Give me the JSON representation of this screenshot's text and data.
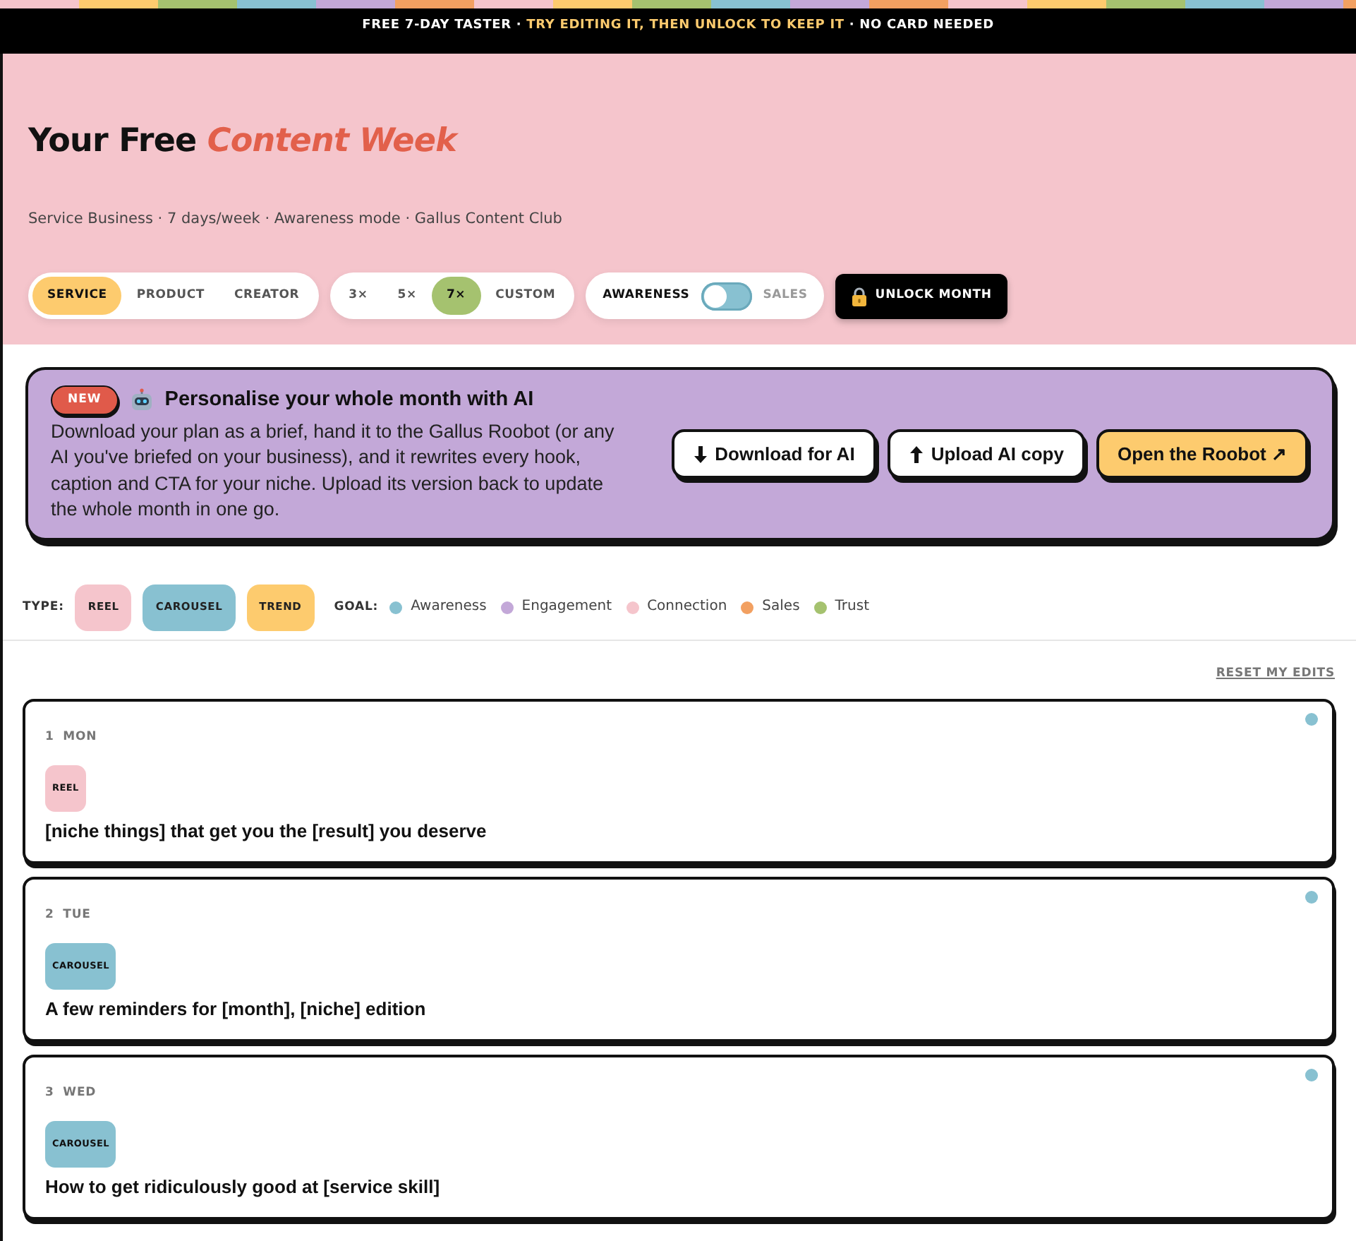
{
  "banner": {
    "segments": [
      {
        "text": "FREE 7-DAY TASTER · ",
        "highlight": false
      },
      {
        "text": "TRY EDITING IT, THEN UNLOCK TO KEEP IT",
        "highlight": true
      },
      {
        "text": " · NO CARD NEEDED",
        "highlight": false
      }
    ]
  },
  "header": {
    "title": "Your Free *Content Week*",
    "subtitle": "Service Business · 7 days/week · Awareness mode · Gallus Content Club"
  },
  "business_type": [
    {
      "label": "SERVICE",
      "selected": true
    },
    {
      "label": "PRODUCT",
      "selected": false
    },
    {
      "label": "CREATOR",
      "selected": false
    }
  ],
  "frequency": [
    {
      "label": "3×",
      "selected": false
    },
    {
      "label": "5×",
      "selected": false
    },
    {
      "label": "7×",
      "selected": true
    },
    {
      "label": "CUSTOM",
      "selected": false
    }
  ],
  "mode_toggle": {
    "left_label": "AWARENESS",
    "right_label": "SALES",
    "on": false
  },
  "unlock_button": {
    "label": "UNLOCK MONTH"
  },
  "ai_promo": {
    "badge": "NEW",
    "title": "Personalise your whole month with AI",
    "text": "Download your plan as a brief, hand it to the Gallus Roobot (or any AI you've briefed on your business), and it rewrites every hook, caption and CTA for your niche. Upload its version back to update the whole month in one go.",
    "buttons": [
      {
        "label": "Download for AI",
        "kind": "download"
      },
      {
        "label": "Upload AI copy",
        "kind": "upload"
      },
      {
        "label": "Open the Roobot ↗",
        "kind": "accent"
      }
    ]
  },
  "legend": {
    "type_label": "TYPE:",
    "types": [
      {
        "label": "REEL",
        "color": "#f5c5cc"
      },
      {
        "label": "CAROUSEL",
        "color": "#88c1d1"
      },
      {
        "label": "TREND",
        "color": "#fdcb6e"
      }
    ],
    "goal_label": "GOAL:",
    "goals": [
      {
        "label": "Awareness",
        "color": "#88c1d1"
      },
      {
        "label": "Engagement",
        "color": "#c3a8d8"
      },
      {
        "label": "Connection",
        "color": "#f5c5cc"
      },
      {
        "label": "Sales",
        "color": "#f2a061"
      },
      {
        "label": "Trust",
        "color": "#a5c26f"
      }
    ]
  },
  "reset_link": "RESET MY EDITS",
  "posts": [
    {
      "day": "1 MON",
      "type": {
        "label": "REEL",
        "color": "#f5c5cc"
      },
      "title": "[niche things] that get you the [result] you deserve",
      "color": "#88c1d1"
    },
    {
      "day": "2 TUE",
      "type": {
        "label": "CAROUSEL",
        "color": "#88c1d1"
      },
      "title": "A few reminders for [month], [niche] edition",
      "color": "#88c1d1"
    },
    {
      "day": "3 WED",
      "type": {
        "label": "CAROUSEL",
        "color": "#88c1d1"
      },
      "title": "How to get ridiculously good at [service skill]",
      "color": "#88c1d1"
    }
  ]
}
